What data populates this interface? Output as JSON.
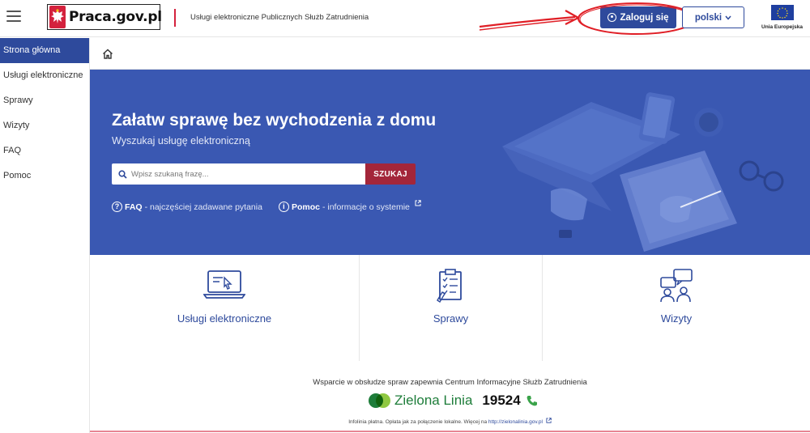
{
  "header": {
    "logo_text": "Praca.gov.pl",
    "subtitle": "Usługi elektroniczne Publicznych Służb Zatrudnienia",
    "login_label": "Zaloguj się",
    "language_label": "polski",
    "eu_label": "Unia Europejska"
  },
  "sidebar": {
    "items": [
      {
        "label": "Strona główna",
        "active": true
      },
      {
        "label": "Usługi elektroniczne"
      },
      {
        "label": "Sprawy"
      },
      {
        "label": "Wizyty"
      },
      {
        "label": "FAQ"
      },
      {
        "label": "Pomoc"
      }
    ]
  },
  "hero": {
    "title": "Załatw sprawę bez wychodzenia z domu",
    "subtitle": "Wyszukaj usługę elektroniczną",
    "search_placeholder": "Wpisz szukaną frazę...",
    "search_button": "SZUKAJ",
    "faq_label": "FAQ",
    "faq_desc": " - najczęściej zadawane pytania",
    "help_label": "Pomoc",
    "help_desc": " - informacje o systemie"
  },
  "tiles": [
    {
      "label": "Usługi elektroniczne",
      "icon": "laptop-icon"
    },
    {
      "label": "Sprawy",
      "icon": "clipboard-icon"
    },
    {
      "label": "Wizyty",
      "icon": "meeting-icon"
    }
  ],
  "footer": {
    "support_text": "Wsparcie w obsłudze spraw zapewnia Centrum Informacyjne Służb Zatrudnienia",
    "green_line_name": "Zielona Linia",
    "green_line_number": "19524",
    "note_prefix": "Infolinia płatna. Opłata jak za połączenie lokalne. Więcej na ",
    "note_link": "http://zielonalinia.gov.pl"
  },
  "colors": {
    "primary": "#2e4a9c",
    "hero_bg": "#3a58b2",
    "search_button": "#a3263a",
    "accent_red": "#d4213d",
    "green": "#1e7d3a"
  }
}
